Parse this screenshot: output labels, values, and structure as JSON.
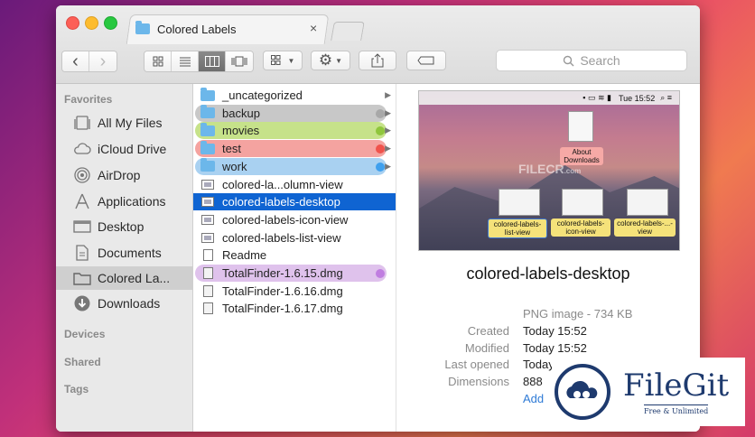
{
  "window": {
    "tab_title": "Colored Labels",
    "tab_close": "×"
  },
  "toolbar": {
    "back": "‹",
    "forward": "›",
    "search_placeholder": "Search"
  },
  "sidebar": {
    "favorites_heading": "Favorites",
    "items": [
      {
        "label": "All My Files",
        "icon": "all-files-icon"
      },
      {
        "label": "iCloud Drive",
        "icon": "cloud-icon"
      },
      {
        "label": "AirDrop",
        "icon": "airdrop-icon"
      },
      {
        "label": "Applications",
        "icon": "applications-icon"
      },
      {
        "label": "Desktop",
        "icon": "desktop-icon"
      },
      {
        "label": "Documents",
        "icon": "documents-icon"
      },
      {
        "label": "Colored La...",
        "icon": "folder-icon"
      },
      {
        "label": "Downloads",
        "icon": "downloads-icon"
      }
    ],
    "devices_heading": "Devices",
    "shared_heading": "Shared",
    "tags_heading": "Tags"
  },
  "files": [
    {
      "name": "_uncategorized",
      "kind": "folder",
      "label_color": "",
      "has_arrow": true
    },
    {
      "name": "backup",
      "kind": "folder",
      "label_color": "#c8c8c8",
      "dot": "#a8a8a8",
      "has_arrow": true
    },
    {
      "name": "movies",
      "kind": "folder",
      "label_color": "#c6e28a",
      "dot": "#8fc63c",
      "has_arrow": true
    },
    {
      "name": "test",
      "kind": "folder",
      "label_color": "#f4a3a0",
      "dot": "#f0534c",
      "has_arrow": true
    },
    {
      "name": "work",
      "kind": "folder",
      "label_color": "#a9d1f1",
      "dot": "#3fa0ee",
      "has_arrow": true
    },
    {
      "name": "colored-la...olumn-view",
      "kind": "image",
      "label_color": "",
      "has_arrow": false
    },
    {
      "name": "colored-labels-desktop",
      "kind": "image",
      "label_color": "",
      "selected": true,
      "has_arrow": false
    },
    {
      "name": "colored-labels-icon-view",
      "kind": "image",
      "label_color": "",
      "has_arrow": false
    },
    {
      "name": "colored-labels-list-view",
      "kind": "image",
      "label_color": "",
      "has_arrow": false
    },
    {
      "name": "Readme",
      "kind": "doc",
      "label_color": "",
      "has_arrow": false
    },
    {
      "name": "TotalFinder-1.6.15.dmg",
      "kind": "dmg",
      "label_color": "#dfc2ec",
      "dot": "#c07ee0",
      "has_arrow": false
    },
    {
      "name": "TotalFinder-1.6.16.dmg",
      "kind": "dmg",
      "label_color": "",
      "has_arrow": false
    },
    {
      "name": "TotalFinder-1.6.17.dmg",
      "kind": "dmg",
      "label_color": "",
      "has_arrow": false
    }
  ],
  "preview": {
    "thumb_menubar_time": "Tue 15:52",
    "thumb_watermark": "FILECR",
    "thumb_watermark_sub": ".com",
    "thumb_about_label": "About Downloads",
    "thumb_bottom_labels": [
      "colored-labels-list-view",
      "colored-labels-icon-view",
      "colored-labels-...-view"
    ],
    "title": "colored-labels-desktop",
    "kind": "PNG image - 734 KB",
    "meta": [
      {
        "key": "Created",
        "value": "Today 15:52"
      },
      {
        "key": "Modified",
        "value": "Today 15:52"
      },
      {
        "key": "Last opened",
        "value": "Today 15:52"
      },
      {
        "key": "Dimensions",
        "value": "888"
      }
    ],
    "add_tags": "Add"
  },
  "watermark": {
    "name": "FileGit",
    "tagline": "Free & Unlimited"
  },
  "colors": {
    "selection": "#0f64d2",
    "accent_blue": "#2f7bd6"
  }
}
